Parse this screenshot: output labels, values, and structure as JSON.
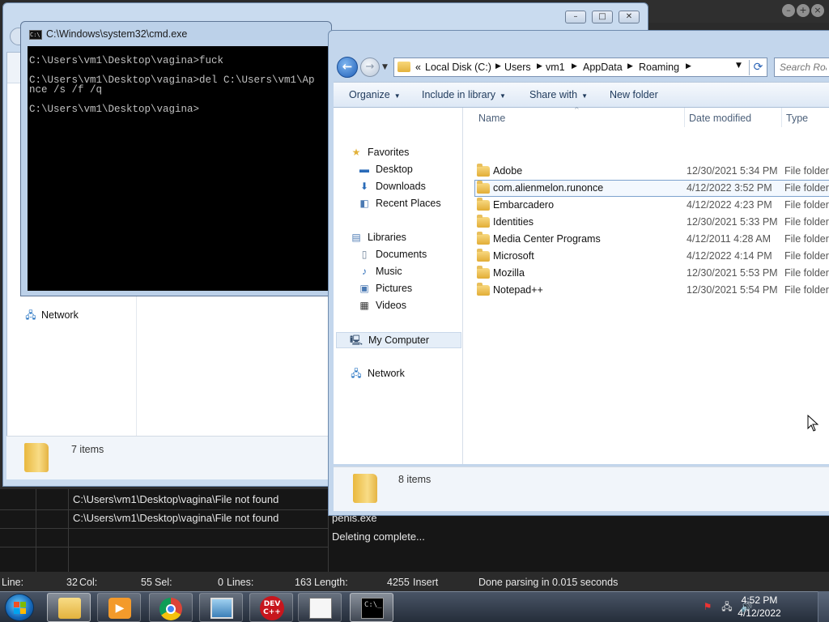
{
  "cmd": {
    "title": "C:\\Windows\\system32\\cmd.exe",
    "lines": [
      "C:\\Users\\vm1\\Desktop\\vagina>fuck",
      "",
      "C:\\Users\\vm1\\Desktop\\vagina>del C:\\Users\\vm1\\Ap",
      "nce /s /f /q",
      "",
      "C:\\Users\\vm1\\Desktop\\vagina>"
    ]
  },
  "background_explorer": {
    "nav_network": "Network",
    "status_count": "7 items"
  },
  "explorer": {
    "breadcrumb": [
      "Local Disk (C:)",
      "Users",
      "vm1",
      "AppData",
      "Roaming"
    ],
    "breadcrumb_overflow": "«",
    "search_placeholder": "Search Roaming",
    "toolbar": {
      "organize": "Organize",
      "include_in_library": "Include in library",
      "share_with": "Share with",
      "new_folder": "New folder"
    },
    "nav": {
      "favorites": "Favorites",
      "desktop": "Desktop",
      "downloads": "Downloads",
      "recent_places": "Recent Places",
      "libraries": "Libraries",
      "documents": "Documents",
      "music": "Music",
      "pictures": "Pictures",
      "videos": "Videos",
      "my_computer": "My Computer",
      "network": "Network"
    },
    "columns": {
      "name": "Name",
      "date_modified": "Date modified",
      "type": "Type"
    },
    "files": [
      {
        "name": "Adobe",
        "date": "12/30/2021 5:34 PM",
        "type": "File folder"
      },
      {
        "name": "com.alienmelon.runonce",
        "date": "4/12/2022 3:52 PM",
        "type": "File folder"
      },
      {
        "name": "Embarcadero",
        "date": "4/12/2022 4:23 PM",
        "type": "File folder"
      },
      {
        "name": "Identities",
        "date": "12/30/2021 5:33 PM",
        "type": "File folder"
      },
      {
        "name": "Media Center Programs",
        "date": "4/12/2011 4:28 AM",
        "type": "File folder"
      },
      {
        "name": "Microsoft",
        "date": "4/12/2022 4:14 PM",
        "type": "File folder"
      },
      {
        "name": "Mozilla",
        "date": "12/30/2021 5:53 PM",
        "type": "File folder"
      },
      {
        "name": "Notepad++",
        "date": "12/30/2021 5:54 PM",
        "type": "File folder"
      }
    ],
    "status_count": "8 items"
  },
  "ide": {
    "log": [
      {
        "col1": "C:\\Users\\vm1\\Desktop\\vagina\\File not found",
        "col2": ""
      },
      {
        "col1": "C:\\Users\\vm1\\Desktop\\vagina\\File not found",
        "col2": "penis.exe"
      },
      {
        "col1": "",
        "col2": "Deleting complete..."
      }
    ],
    "status": {
      "line_label": "Line:",
      "line_value": "32",
      "col_label": "Col:",
      "col_value": "55",
      "sel_label": "Sel:",
      "sel_value": "0",
      "lines_label": "Lines:",
      "lines_value": "163",
      "length_label": "Length:",
      "length_value": "4255",
      "mode": "Insert",
      "message": "Done parsing in 0.015 seconds"
    }
  },
  "taskbar": {
    "time": "4:52 PM",
    "date": "4/12/2022",
    "devcpp_label": "DEV C++",
    "cmd_icon_text": "C:\\_"
  }
}
